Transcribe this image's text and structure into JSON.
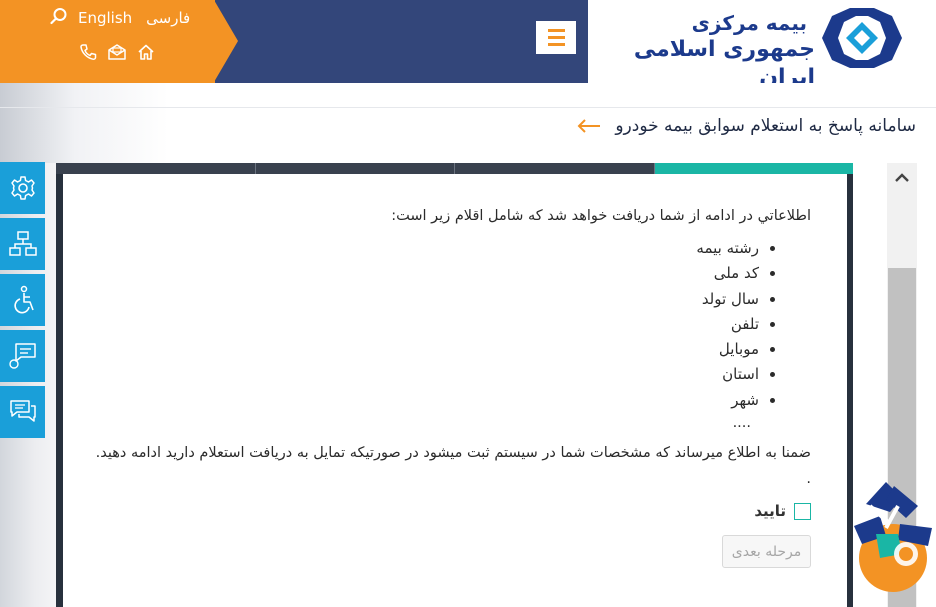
{
  "header": {
    "lang_fa": "فارسی",
    "lang_en": "English",
    "logo_line1": "بیمه مرکزی",
    "logo_line2": "جمهوری اسلامی ایران",
    "colors": {
      "orange": "#f39324",
      "navy": "#33467a",
      "logo_blue": "#1c3a8c"
    },
    "icons": [
      "search-icon",
      "home-icon",
      "mail-icon",
      "phone-icon",
      "hamburger-menu-icon"
    ]
  },
  "page": {
    "title": "سامانه پاسخ به استعلام سوابق بیمه خودرو"
  },
  "sidebar": {
    "icons": [
      "settings-icon",
      "sitemap-icon",
      "accessibility-icon",
      "comment-icon",
      "chat-icon"
    ],
    "color": "#1a9fd9"
  },
  "panel": {
    "tabs_active": 4,
    "accent": "#1ab6a5",
    "intro": "اطلاعاتي در ادامه از شما دريافت خواهد شد که شامل اقلام زير است:",
    "items": [
      "رشته بیمه",
      "کد ملی",
      "سال تولد",
      "تلفن",
      "موبایل",
      "استان",
      "شهر"
    ],
    "ellipsis": "....",
    "notice": "ضمنا به اطلاع میرساند که مشخصات شما در سیستم ثبت میشود در صورتیکه تمایل به دریافت استعلام دارید ادامه دهید. .",
    "confirm_label": "تایید",
    "next_button": "مرحله بعدی"
  }
}
